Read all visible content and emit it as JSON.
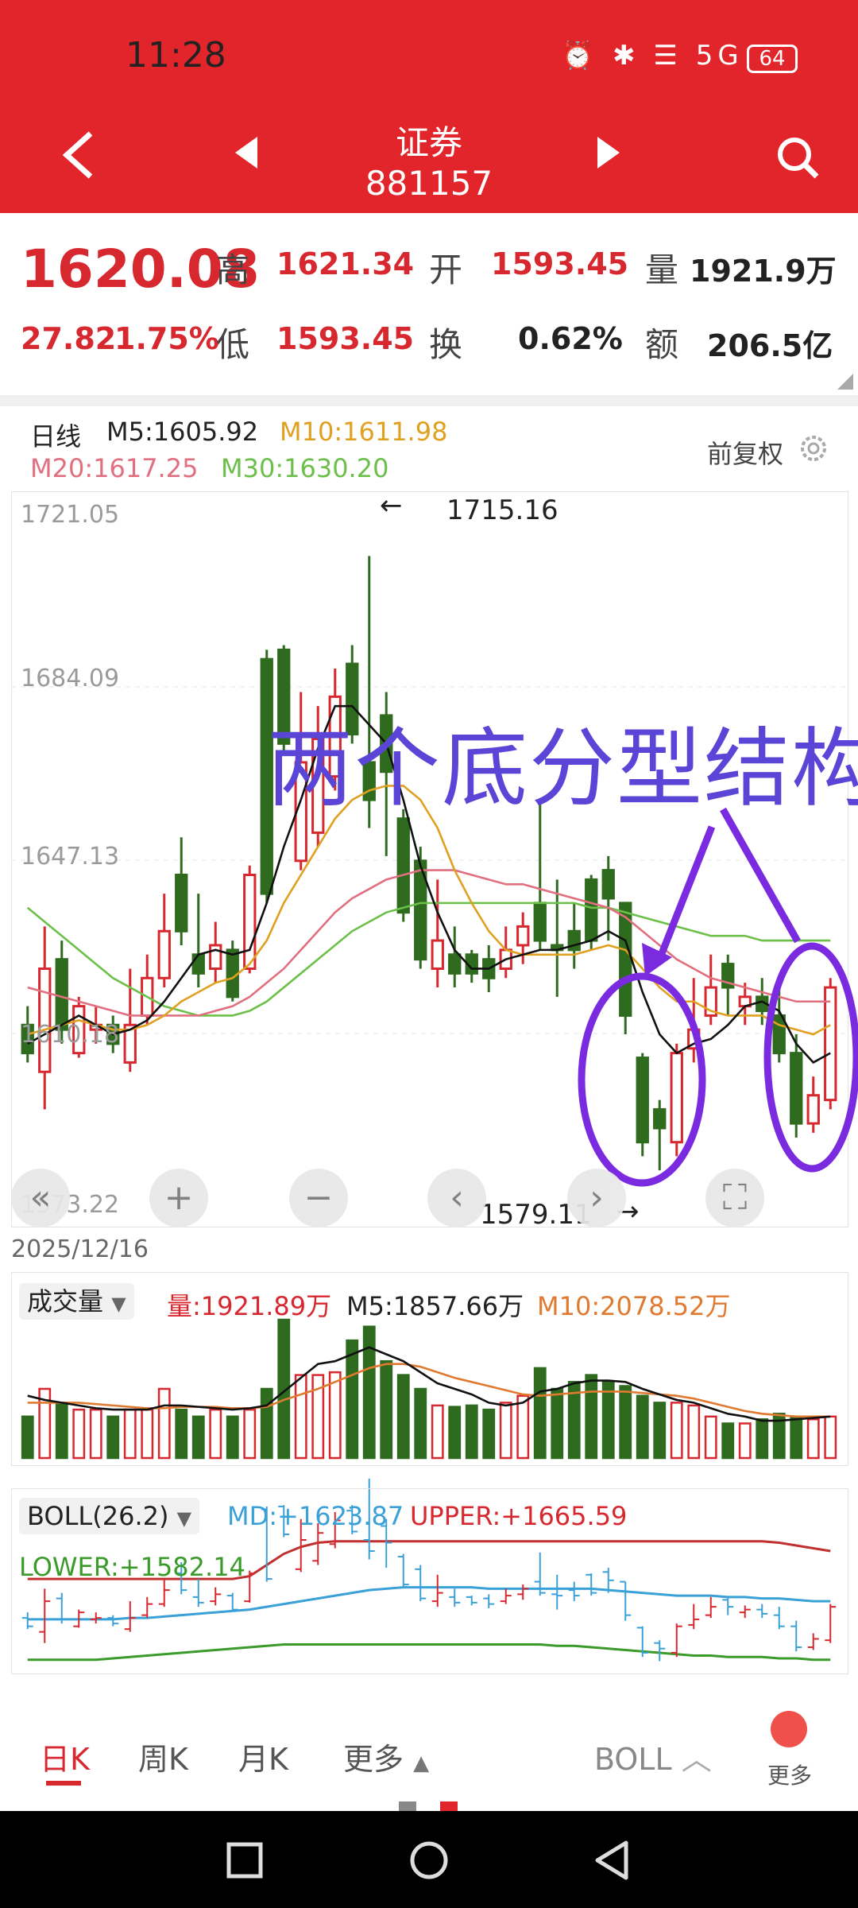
{
  "status": {
    "time": "11:28",
    "icons": "⏰ ✱ ☰ 5G ",
    "battery": "64"
  },
  "header": {
    "title": "证券",
    "code": "881157"
  },
  "quote": {
    "price": "1620.08",
    "change": "27.82",
    "change_pct": "1.75%",
    "high_label": "高",
    "high": "1621.34",
    "open_label": "开",
    "open": "1593.45",
    "vol_label": "量",
    "vol": "1921.9万",
    "low_label": "低",
    "low": "1593.45",
    "turnover_label": "换",
    "turnover": "0.62%",
    "amount_label": "额",
    "amount": "206.5亿"
  },
  "kline": {
    "period": "日线",
    "m5": "M5:1605.92",
    "m10": "M10:1611.98",
    "m20": "M20:1617.25",
    "m30": "M30:1630.20",
    "adjust": "前复权",
    "ylabels": [
      "1721.05",
      "1684.09",
      "1647.13",
      "1610.18",
      "1573.22"
    ],
    "max_label": "1715.16",
    "min_label": "1579.11",
    "date": "2025/12/16",
    "annotation": "两个底分型结构",
    "colors": {
      "up": "#d8282f",
      "down": "#2e6b1e",
      "ma5": "#111111",
      "ma10": "#e0a020",
      "ma20": "#e07080",
      "ma30": "#6cc04a",
      "annot": "#7a2be0"
    }
  },
  "volume": {
    "selector": "成交量",
    "vol": "量:1921.89万",
    "m5": "M5:1857.66万",
    "m10": "M10:2078.52万"
  },
  "boll": {
    "selector": "BOLL(26.2)",
    "md": "MD:+1623.87",
    "upper": "UPPER:+1665.59",
    "lower": "LOWER:+1582.14"
  },
  "tabs": {
    "day": "日K",
    "week": "周K",
    "month": "月K",
    "more": "更多",
    "indicator": "BOLL",
    "more_btn": "更多"
  },
  "chart_data": {
    "type": "candlestick",
    "ylim": [
      1573.22,
      1721.05
    ],
    "candles": [
      [
        1612,
        1606,
        1616,
        1604
      ],
      [
        1602,
        1624,
        1633,
        1594
      ],
      [
        1626,
        1611,
        1630,
        1608
      ],
      [
        1606,
        1616,
        1618,
        1605
      ],
      [
        1611,
        1612,
        1616,
        1608
      ],
      [
        1612,
        1608,
        1614,
        1606
      ],
      [
        1604,
        1612,
        1624,
        1602
      ],
      [
        1614,
        1622,
        1627,
        1612
      ],
      [
        1622,
        1632,
        1640,
        1620
      ],
      [
        1644,
        1632,
        1652,
        1629
      ],
      [
        1627,
        1623,
        1640,
        1620
      ],
      [
        1624,
        1629,
        1634,
        1621
      ],
      [
        1628,
        1618,
        1630,
        1617
      ],
      [
        1624,
        1644,
        1646,
        1623
      ],
      [
        1690,
        1640,
        1692,
        1638
      ],
      [
        1692,
        1672,
        1693,
        1670
      ],
      [
        1647,
        1668,
        1683,
        1645
      ],
      [
        1653,
        1673,
        1680,
        1650
      ],
      [
        1665,
        1682,
        1688,
        1662
      ],
      [
        1689,
        1674,
        1693,
        1672
      ],
      [
        1668,
        1660,
        1712,
        1654
      ],
      [
        1678,
        1666,
        1683,
        1648
      ],
      [
        1656,
        1636,
        1658,
        1634
      ],
      [
        1647,
        1626,
        1650,
        1624
      ],
      [
        1624,
        1630,
        1643,
        1620
      ],
      [
        1627,
        1623,
        1633,
        1620
      ],
      [
        1627,
        1623,
        1628,
        1621
      ],
      [
        1626,
        1622,
        1629,
        1619
      ],
      [
        1624,
        1628,
        1633,
        1622
      ],
      [
        1629,
        1633,
        1636,
        1625
      ],
      [
        1638,
        1630,
        1659,
        1628
      ],
      [
        1629,
        1628,
        1643,
        1618
      ],
      [
        1632,
        1628,
        1638,
        1624
      ],
      [
        1643,
        1630,
        1644,
        1628
      ],
      [
        1645,
        1639,
        1648,
        1630
      ],
      [
        1638,
        1614,
        1638,
        1610
      ],
      [
        1605,
        1587,
        1606,
        1584
      ],
      [
        1594,
        1590,
        1596,
        1581
      ],
      [
        1587,
        1606,
        1608,
        1584
      ],
      [
        1607,
        1611,
        1622,
        1604
      ],
      [
        1614,
        1620,
        1627,
        1612
      ],
      [
        1625,
        1620,
        1627,
        1614
      ],
      [
        1616,
        1618,
        1621,
        1612
      ],
      [
        1618,
        1615,
        1622,
        1612
      ],
      [
        1614,
        1606,
        1620,
        1604
      ],
      [
        1606,
        1591,
        1610,
        1588
      ],
      [
        1591,
        1597,
        1601,
        1589
      ],
      [
        1596,
        1620,
        1622,
        1594
      ]
    ],
    "ma5": [
      1608,
      1610,
      1612,
      1614,
      1612,
      1610,
      1611,
      1613,
      1617,
      1622,
      1627,
      1628,
      1627,
      1628,
      1638,
      1650,
      1660,
      1671,
      1680,
      1680,
      1676,
      1672,
      1660,
      1646,
      1636,
      1628,
      1624,
      1624,
      1626,
      1627,
      1628,
      1628,
      1629,
      1630,
      1632,
      1630,
      1619,
      1610,
      1606,
      1608,
      1609,
      1612,
      1616,
      1617,
      1615,
      1608,
      1604,
      1606
    ],
    "ma10": [
      1610,
      1611,
      1612,
      1613,
      1612,
      1611,
      1611,
      1612,
      1614,
      1617,
      1619,
      1621,
      1622,
      1625,
      1630,
      1638,
      1644,
      1650,
      1656,
      1660,
      1662,
      1663,
      1663,
      1660,
      1654,
      1645,
      1638,
      1632,
      1628,
      1627,
      1627,
      1627,
      1627,
      1628,
      1629,
      1628,
      1624,
      1620,
      1617,
      1617,
      1615,
      1614,
      1614,
      1614,
      1612,
      1611,
      1610,
      1612
    ],
    "ma20": [
      1620,
      1619,
      1618,
      1617,
      1616,
      1615,
      1614,
      1614,
      1614,
      1614,
      1614,
      1615,
      1616,
      1618,
      1621,
      1624,
      1628,
      1632,
      1636,
      1639,
      1641,
      1643,
      1644,
      1645,
      1645,
      1645,
      1644,
      1643,
      1642,
      1642,
      1641,
      1640,
      1639,
      1638,
      1637,
      1635,
      1632,
      1629,
      1626,
      1624,
      1622,
      1621,
      1620,
      1619,
      1618,
      1617,
      1617,
      1617
    ],
    "ma30": [
      1637,
      1634,
      1631,
      1628,
      1625,
      1622,
      1620,
      1618,
      1616,
      1615,
      1614,
      1614,
      1614,
      1615,
      1617,
      1620,
      1623,
      1626,
      1629,
      1632,
      1634,
      1636,
      1637,
      1638,
      1638,
      1638,
      1638,
      1638,
      1638,
      1638,
      1638,
      1638,
      1638,
      1637,
      1637,
      1636,
      1635,
      1634,
      1633,
      1632,
      1631,
      1631,
      1631,
      1630,
      1630,
      1630,
      1630,
      1630
    ],
    "volume": [
      0.3,
      0.5,
      0.4,
      0.35,
      0.35,
      0.3,
      0.35,
      0.35,
      0.5,
      0.35,
      0.3,
      0.35,
      0.3,
      0.35,
      0.5,
      1.0,
      0.6,
      0.6,
      0.62,
      0.85,
      0.95,
      0.7,
      0.6,
      0.5,
      0.38,
      0.37,
      0.38,
      0.35,
      0.4,
      0.45,
      0.65,
      0.5,
      0.55,
      0.6,
      0.55,
      0.52,
      0.45,
      0.4,
      0.4,
      0.38,
      0.3,
      0.25,
      0.25,
      0.28,
      0.32,
      0.3,
      0.28,
      0.3
    ],
    "vol_ma5": [
      0.45,
      0.42,
      0.4,
      0.38,
      0.36,
      0.35,
      0.35,
      0.35,
      0.38,
      0.38,
      0.37,
      0.36,
      0.35,
      0.36,
      0.38,
      0.48,
      0.58,
      0.68,
      0.7,
      0.75,
      0.8,
      0.75,
      0.7,
      0.62,
      0.54,
      0.5,
      0.46,
      0.4,
      0.38,
      0.4,
      0.48,
      0.5,
      0.54,
      0.56,
      0.56,
      0.55,
      0.5,
      0.46,
      0.42,
      0.4,
      0.36,
      0.32,
      0.3,
      0.27,
      0.27,
      0.28,
      0.29,
      0.3
    ],
    "vol_ma10": [
      0.4,
      0.4,
      0.4,
      0.4,
      0.39,
      0.38,
      0.37,
      0.36,
      0.36,
      0.37,
      0.37,
      0.37,
      0.36,
      0.36,
      0.37,
      0.42,
      0.46,
      0.5,
      0.55,
      0.6,
      0.65,
      0.68,
      0.68,
      0.66,
      0.62,
      0.58,
      0.55,
      0.52,
      0.49,
      0.46,
      0.45,
      0.46,
      0.47,
      0.48,
      0.48,
      0.48,
      0.47,
      0.46,
      0.45,
      0.43,
      0.4,
      0.37,
      0.34,
      0.32,
      0.31,
      0.3,
      0.3,
      0.3
    ],
    "boll_upper": [
      1640,
      1640,
      1640,
      1640,
      1640,
      1640,
      1640,
      1640,
      1640,
      1640,
      1640,
      1640,
      1640,
      1642,
      1650,
      1658,
      1663,
      1666,
      1667,
      1667,
      1667,
      1667,
      1667,
      1667,
      1667,
      1667,
      1667,
      1667,
      1667,
      1667,
      1667,
      1667,
      1667,
      1667,
      1667,
      1667,
      1667,
      1667,
      1667,
      1667,
      1667,
      1667,
      1667,
      1667,
      1666,
      1664,
      1662,
      1660
    ],
    "boll_md": [
      1611,
      1611,
      1611,
      1611,
      1611,
      1611,
      1612,
      1612,
      1613,
      1614,
      1615,
      1616,
      1617,
      1618,
      1620,
      1622,
      1624,
      1626,
      1628,
      1630,
      1632,
      1633,
      1634,
      1634,
      1634,
      1634,
      1634,
      1633,
      1633,
      1633,
      1633,
      1633,
      1633,
      1633,
      1632,
      1631,
      1630,
      1629,
      1628,
      1628,
      1628,
      1627,
      1627,
      1626,
      1626,
      1625,
      1624,
      1624
    ],
    "boll_lower": [
      1582,
      1582,
      1582,
      1582,
      1582,
      1583,
      1584,
      1585,
      1586,
      1587,
      1588,
      1589,
      1590,
      1591,
      1592,
      1593,
      1593,
      1593,
      1593,
      1593,
      1593,
      1593,
      1593,
      1593,
      1593,
      1593,
      1593,
      1593,
      1593,
      1593,
      1593,
      1592,
      1592,
      1591,
      1590,
      1589,
      1588,
      1587,
      1586,
      1585,
      1585,
      1584,
      1584,
      1584,
      1583,
      1583,
      1582,
      1582
    ]
  }
}
